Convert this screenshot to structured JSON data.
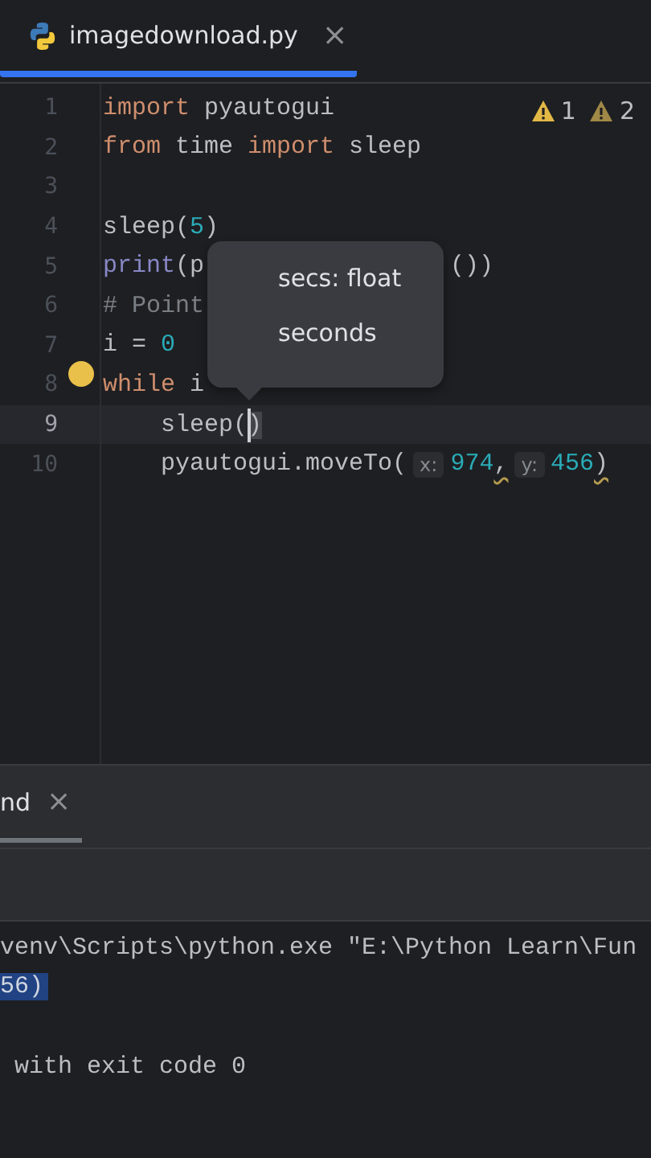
{
  "tab": {
    "title": "imagedownload.py",
    "close": "×",
    "selected": true
  },
  "inspections": [
    {
      "kind": "warning",
      "count": "1"
    },
    {
      "kind": "weak-warning",
      "count": "2"
    }
  ],
  "lines": [
    {
      "number": "1",
      "current": false,
      "tokens": [
        {
          "kind": "keyword",
          "text": "import"
        },
        {
          "kind": "plain",
          "text": " pyautogui"
        }
      ]
    },
    {
      "number": "2",
      "current": false,
      "tokens": [
        {
          "kind": "keyword",
          "text": "from"
        },
        {
          "kind": "plain",
          "text": " time "
        },
        {
          "kind": "keyword",
          "text": "import"
        },
        {
          "kind": "plain",
          "text": " sleep"
        }
      ]
    },
    {
      "number": "3",
      "current": false
    },
    {
      "number": "4",
      "current": false,
      "tokens": [
        {
          "kind": "plain",
          "text": "sleep("
        },
        {
          "kind": "number",
          "text": "5"
        },
        {
          "kind": "plain",
          "text": ")"
        }
      ]
    },
    {
      "number": "5",
      "current": false,
      "tokens": [
        {
          "kind": "builtin",
          "text": "print"
        },
        {
          "kind": "plain",
          "text": "(p"
        }
      ],
      "tokens_right": [
        {
          "kind": "plain",
          "text": "())"
        }
      ]
    },
    {
      "number": "6",
      "current": false,
      "tokens": [
        {
          "kind": "comment",
          "text": "# Point"
        }
      ]
    },
    {
      "number": "7",
      "current": false,
      "tokens": [
        {
          "kind": "plain",
          "text": "i = "
        },
        {
          "kind": "number",
          "text": "0"
        }
      ]
    },
    {
      "number": "8",
      "current": false,
      "tokens": [
        {
          "kind": "keyword",
          "text": "while"
        },
        {
          "kind": "plain",
          "text": " i"
        }
      ]
    },
    {
      "number": "9",
      "current": true,
      "indented": true,
      "tokens": [
        {
          "kind": "plain",
          "text": "sleep("
        },
        {
          "kind": "cursor",
          "text": ")"
        }
      ]
    },
    {
      "number": "10",
      "current": false,
      "indented": true,
      "tokens": [
        {
          "kind": "plain",
          "text": "pyautogui.moveTo("
        },
        {
          "kind": "hint",
          "text": "x:"
        },
        {
          "kind": "number",
          "text": "974"
        },
        {
          "kind": "squiggle",
          "text": ","
        },
        {
          "kind": "hint",
          "text": "y:"
        },
        {
          "kind": "number",
          "text": "456"
        },
        {
          "kind": "squiggle",
          "text": ")"
        }
      ]
    }
  ],
  "param_popup": {
    "signature": "secs: float",
    "description": "seconds"
  },
  "run_panel": {
    "tab": {
      "title": "nd",
      "close": "×",
      "selected": true
    },
    "output": [
      {
        "kind": "plain",
        "text": "venv\\Scripts\\python.exe \"E:\\Python Learn\\Fun"
      },
      {
        "kind": "selected",
        "text": "56)"
      },
      {
        "kind": "blank"
      },
      {
        "kind": "plain",
        "text": " with exit code 0"
      }
    ]
  }
}
